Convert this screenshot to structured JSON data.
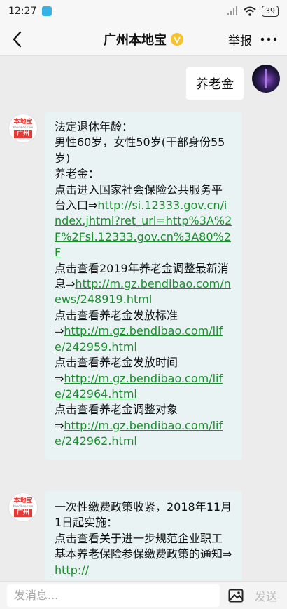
{
  "status_bar": {
    "time": "12:27",
    "battery": "39"
  },
  "nav": {
    "title": "广州本地宝",
    "report_label": "举报"
  },
  "messages": [
    {
      "from": "user",
      "text": "养老金"
    },
    {
      "from": "bot",
      "avatar": {
        "logo_top": "本地宝",
        "logo_mid": "bendibao.com",
        "logo_city": "广州"
      },
      "lines": [
        "法定退休年龄：",
        "男性60岁，女性50岁(干部身份55岁)",
        "养老金：",
        "点击进入国家社会保险公共服务平台入口⇒",
        "http://si.12333.gov.cn/index.jhtml?ret_url=http%3A%2F%2Fsi.12333.gov.cn%3A80%2F",
        "点击查看2019年养老金调整最新消息⇒",
        "http://m.gz.bendibao.com/news/248919.html",
        "点击查看养老金发放标准",
        "⇒",
        "http://m.gz.bendibao.com/life/242959.html",
        "点击查看养老金发放时间",
        "⇒",
        "http://m.gz.bendibao.com/life/242964.html",
        "点击查看养老金调整对象",
        "⇒",
        "http://m.gz.bendibao.com/life/242962.html"
      ]
    },
    {
      "from": "bot",
      "avatar": {
        "logo_top": "本地宝",
        "logo_mid": "bendibao.com",
        "logo_city": "广州"
      },
      "lines": [
        "一次性缴费政策收紧，2018年11月1日起实施：",
        "点击查看关于进一步规范企业职工基本养老保险参保缴费政策的通知⇒",
        "http://"
      ]
    }
  ],
  "composer": {
    "placeholder": "发消息...",
    "send_label": "发送"
  }
}
